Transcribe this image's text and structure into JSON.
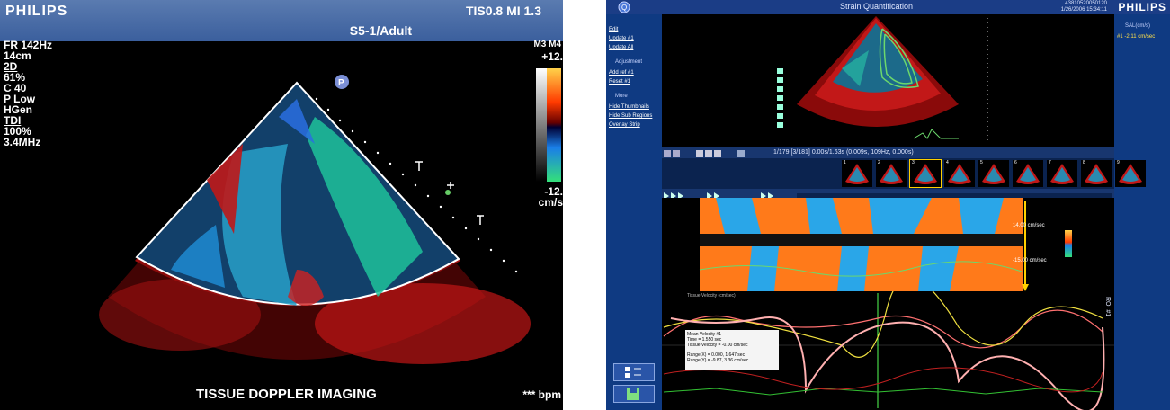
{
  "left_panel": {
    "brand": "PHILIPS",
    "tis_mi": "TIS0.8  MI 1.3",
    "probe": "S5-1/Adult",
    "frame_rate": "FR 142Hz",
    "depth": "14cm",
    "params": [
      {
        "text": "2D",
        "underline": true
      },
      {
        "text": " 61%",
        "underline": false
      },
      {
        "text": "C 40",
        "underline": false
      },
      {
        "text": "P Low",
        "underline": false
      },
      {
        "text": "HGen",
        "underline": false
      },
      {
        "text": "TDI",
        "underline": true
      },
      {
        "text": "100%",
        "underline": false
      },
      {
        "text": "3.4MHz",
        "underline": false
      }
    ],
    "colorbar_label": "M3 M4",
    "colorbar_top": "+12.",
    "colorbar_bottom": "-12.",
    "colorbar_unit": "cm/s",
    "caption": "TISSUE DOPPLER IMAGING",
    "bpm": "*** bpm",
    "marker_p": "P"
  },
  "right_panel": {
    "title": "Strain Quantification",
    "brand": "PHILIPS",
    "header_info": "43810520050120\n1/26/2006 15:34:11",
    "qlab_label": "Q",
    "sidebar_items": [
      {
        "text": "Edit",
        "kind": "link"
      },
      {
        "text": "Update #1",
        "kind": "link"
      },
      {
        "text": "Update All",
        "kind": "link"
      },
      {
        "text": "Adjustment",
        "kind": "section"
      },
      {
        "text": "Add ref #1",
        "kind": "link"
      },
      {
        "text": "Reset #1",
        "kind": "link"
      },
      {
        "text": "More",
        "kind": "section"
      },
      {
        "text": "Hide Thumbnails",
        "kind": "link"
      },
      {
        "text": "Hide Sub Regions",
        "kind": "link"
      },
      {
        "text": "Overlay Strip",
        "kind": "link"
      }
    ],
    "rsb_header": "SAL(cm/s)",
    "rsb_value": "#1   -2.11 cm/sec",
    "frame_label": "1/179  [3/181] 0.00s/1.63s  (0.009s, 109Hz, 0.000s)",
    "thumb_numbers": [
      "1",
      "2",
      "3",
      "4",
      "5",
      "6",
      "7",
      "8",
      "9"
    ],
    "scale_high": "14.00 cm/sec",
    "scale_low": "-15.00 cm/sec",
    "graph_title": "Tissue Velocity (cm/sec)",
    "legend": {
      "title": "Mean Velocity #1",
      "lines": [
        "Time = 1.550 sec",
        "Tissue Velocity = -0.00 cm/sec",
        "",
        "Range(X) = 0.000, 1.647 sec",
        "Range(Y) = -9.87, 3.36 cm/sec"
      ]
    },
    "vertical_label": "ROI #1"
  }
}
